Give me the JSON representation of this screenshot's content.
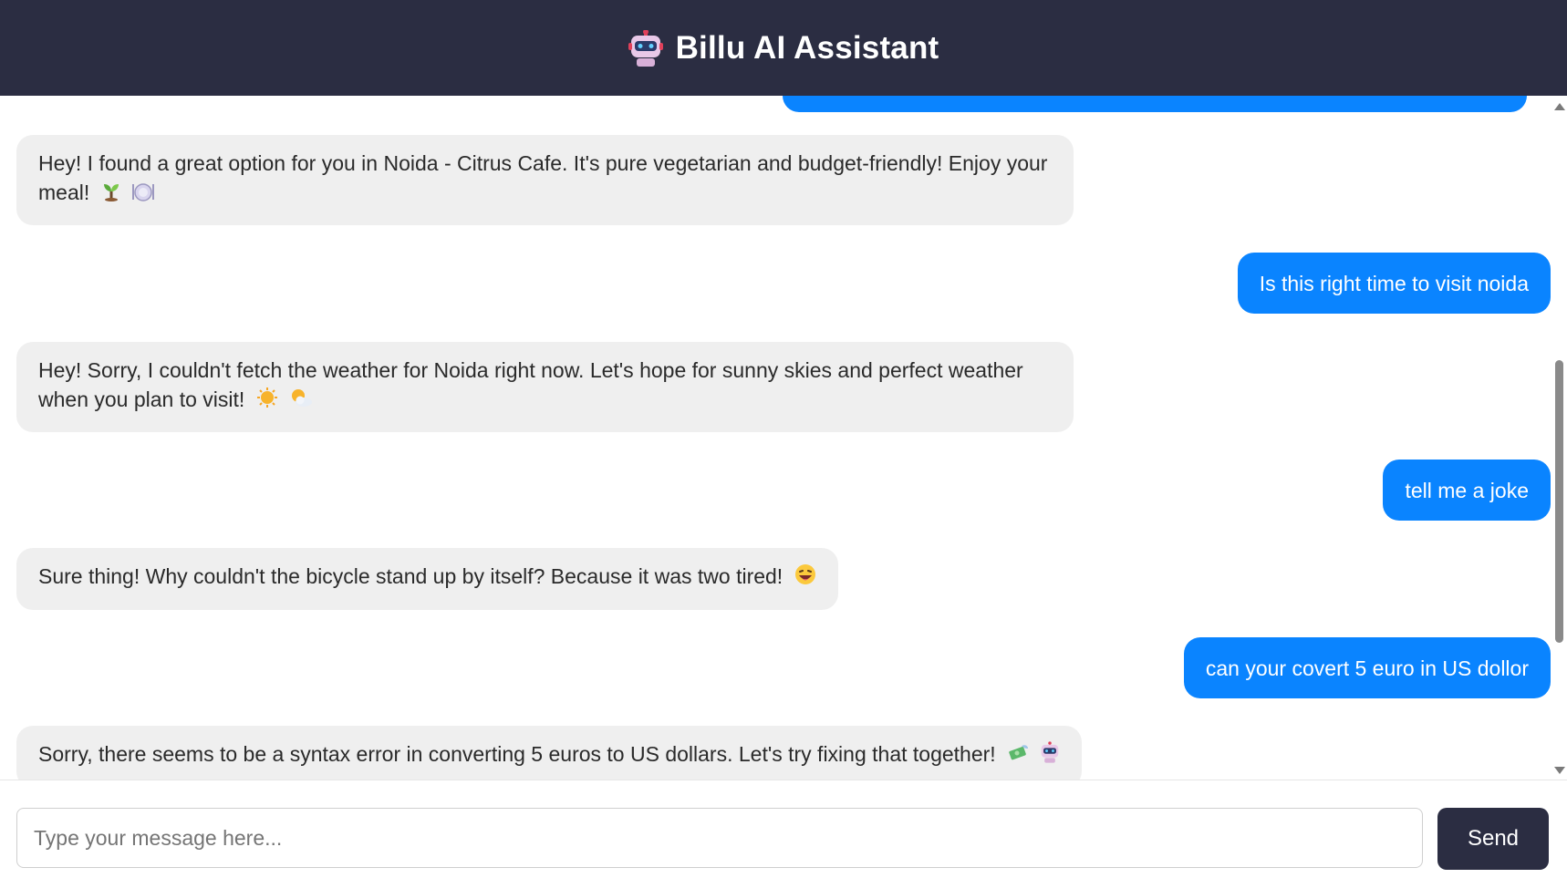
{
  "header": {
    "title": "Billu AI Assistant",
    "icon": "robot-icon"
  },
  "messages": [
    {
      "role": "user",
      "text": ""
    },
    {
      "role": "bot",
      "text": "Hey! I found a great option for you in Noida - Citrus Cafe. It's pure vegetarian and budget-friendly! Enjoy your meal!",
      "emojis": [
        "seedling-icon",
        "plate-icon"
      ]
    },
    {
      "role": "user",
      "text": "Is this right time to visit noida"
    },
    {
      "role": "bot",
      "text": "Hey! Sorry, I couldn't fetch the weather for Noida right now. Let's hope for sunny skies and perfect weather when you plan to visit!",
      "emojis": [
        "sun-icon",
        "sun-cloud-icon"
      ]
    },
    {
      "role": "user",
      "text": "tell me a joke"
    },
    {
      "role": "bot",
      "text": "Sure thing! Why couldn't the bicycle stand up by itself? Because it was two tired!",
      "emojis": [
        "grinning-face-icon"
      ]
    },
    {
      "role": "user",
      "text": "can your covert 5 euro in US dollor"
    },
    {
      "role": "bot",
      "text": "Sorry, there seems to be a syntax error in converting 5 euros to US dollars. Let's try fixing that together!",
      "emojis": [
        "money-wings-icon",
        "robot-icon"
      ]
    }
  ],
  "input": {
    "placeholder": "Type your message here...",
    "value": ""
  },
  "send_button": {
    "label": "Send"
  },
  "colors": {
    "header_bg": "#2b2d42",
    "user_bubble": "#0a84ff",
    "bot_bubble": "#efefef",
    "send_bg": "#2b2d42"
  }
}
